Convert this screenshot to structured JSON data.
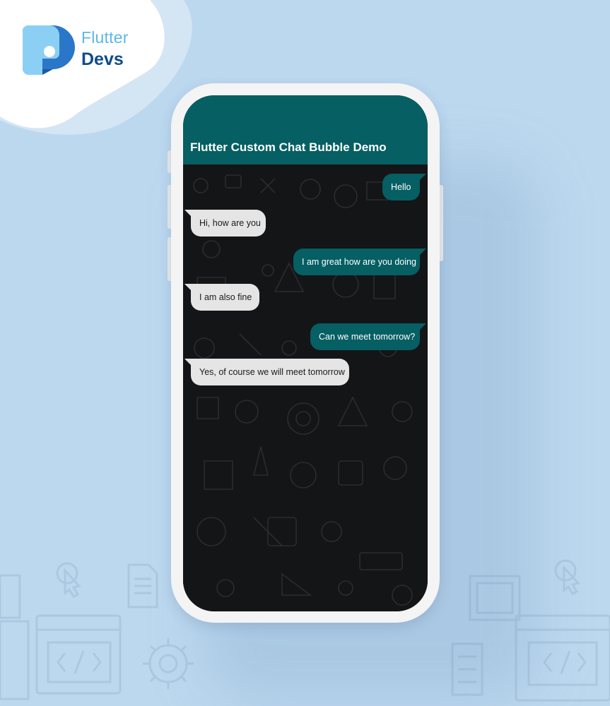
{
  "brand": {
    "line1": "Flutter",
    "line2": "Devs"
  },
  "app": {
    "title": "Flutter Custom Chat Bubble Demo"
  },
  "colors": {
    "background": "#bcd8ef",
    "appbar": "#055f63",
    "sent_bubble": "#055f63",
    "received_bubble": "#e5e5e5",
    "chat_background": "#141517"
  },
  "messages": [
    {
      "text": "Hello",
      "side": "sent"
    },
    {
      "text": "Hi, how are you",
      "side": "received"
    },
    {
      "text": "I am great how are you doing",
      "side": "sent"
    },
    {
      "text": "I am also fine",
      "side": "received"
    },
    {
      "text": "Can we meet tomorrow?",
      "side": "sent"
    },
    {
      "text": "Yes, of course we will meet tomorrow",
      "side": "received"
    }
  ],
  "decor_icons": [
    "cursor-click-icon",
    "document-icon",
    "code-window-icon",
    "gear-icon",
    "browser-window-icon",
    "server-icon"
  ]
}
